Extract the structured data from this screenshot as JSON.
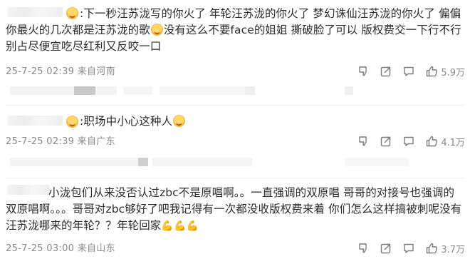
{
  "comments": [
    {
      "text_parts": [
        "下一秒汪苏泷写的你火了 年轮汪苏泷的你火了 梦幻诛仙汪苏泷的你火了 偏偏你最火的几次都是汪苏泷的歌",
        "没有这么不要face的姐姐 撕破脸了可以 版权费交一下行不行 别占尽便宜吃尽红利又反咬一口"
      ],
      "time": "25-7-25 02:39",
      "location": "来自河南",
      "likes": "5.9万"
    },
    {
      "text_parts": [
        "职场中小心这种人",
        ""
      ],
      "time": "25-7-25 02:39",
      "location": "来自广东",
      "likes": "4.1万"
    },
    {
      "text_parts": [
        "小泷包们从来没否认过zbc不是原唱啊。。一直强调的双原唱 哥哥的对接号也强调的双原唱啊。。。哥哥对zbc够好了吧我记得有一次都没收版权费来着 你们怎么这样搞被刺呢没有汪苏泷哪来的年轮？？年轮回家",
        ""
      ],
      "time": "25-7-25 03:00",
      "location": "来自山东",
      "likes": "3.7万"
    }
  ],
  "colors": {
    "text": "#2b2b2b",
    "meta": "#8a8a8a",
    "icon": "#7d7d7d"
  },
  "icons": [
    "dislike-icon",
    "share-icon",
    "comment-icon",
    "like-icon"
  ]
}
